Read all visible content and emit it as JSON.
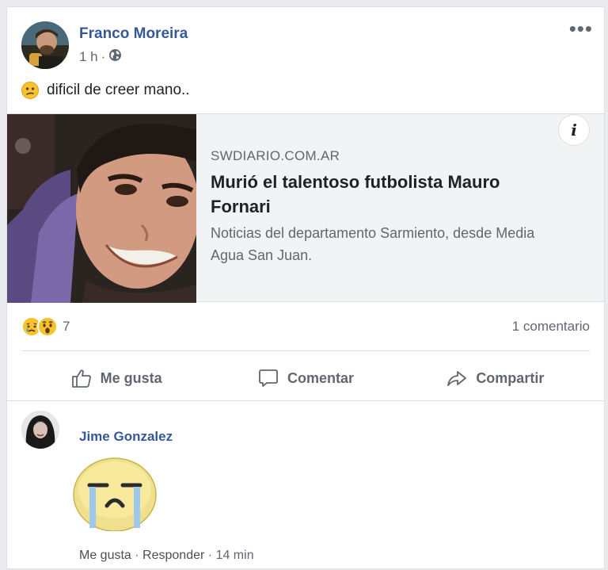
{
  "post": {
    "author": "Franco Moreira",
    "time": "1 h",
    "time_sep": "·",
    "more_label": "•••",
    "status_text": "dificil de creer mano..",
    "status_emoji": "confused-face-icon"
  },
  "link_preview": {
    "domain": "SWDIARIO.COM.AR",
    "headline": "Murió el talentoso futbolista Mauro Fornari",
    "description": "Noticias del departamento Sarmiento, desde Media Agua San Juan.",
    "info_label": "i"
  },
  "reactions": {
    "icons": [
      "sad-face-icon",
      "wow-face-icon"
    ],
    "count": "7",
    "comments_count": "1 comentario"
  },
  "actions": {
    "like": "Me gusta",
    "comment": "Comentar",
    "share": "Compartir"
  },
  "comment": {
    "author": "Jime Gonzalez",
    "sticker": "crying-face-sticker",
    "like": "Me gusta",
    "reply": "Responder",
    "sep": "·",
    "time": "14 min"
  },
  "colors": {
    "link_blue": "#365899",
    "muted": "#606770",
    "background": "#e9ebee"
  }
}
